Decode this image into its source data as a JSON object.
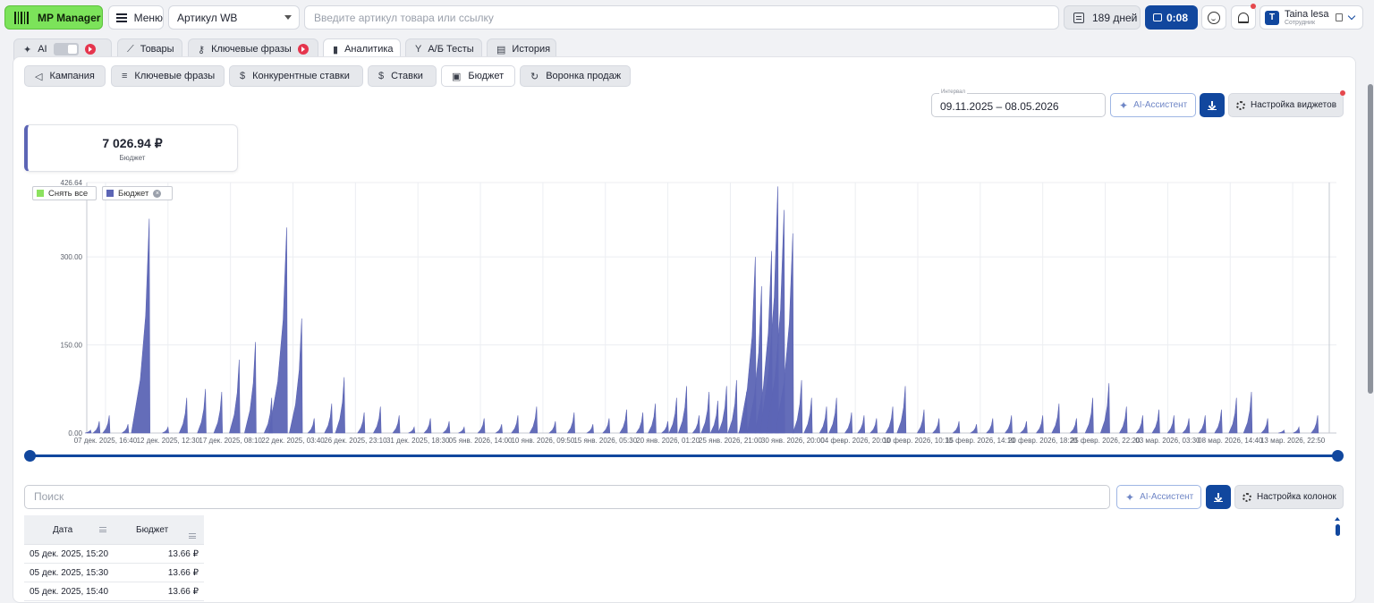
{
  "app": {
    "logo_text": "MP Manager"
  },
  "topbar": {
    "menu_label": "Меню",
    "article_select": "Артикул WB",
    "search_placeholder": "Введите артикул товара или ссылку",
    "days_label": "189 дней",
    "recording_time": "0:08",
    "user_name": "Taina lesa",
    "user_role": "Сотрудник",
    "user_initial": "T"
  },
  "tabs": [
    {
      "label": "AI"
    },
    {
      "label": "Товары"
    },
    {
      "label": "Ключевые фразы"
    },
    {
      "label": "Аналитика",
      "active": true
    },
    {
      "label": "А/Б Тесты"
    },
    {
      "label": "История"
    }
  ],
  "subtabs": [
    {
      "label": "Кампания"
    },
    {
      "label": "Ключевые фразы"
    },
    {
      "label": "Конкурентные ставки"
    },
    {
      "label": "Ставки"
    },
    {
      "label": "Бюджет",
      "active": true
    },
    {
      "label": "Воронка продаж"
    }
  ],
  "controls": {
    "interval_label": "Интервал",
    "interval_value": "09.11.2025 – 08.05.2026",
    "ai_assistant": "AI-Ассистент",
    "widget_settings": "Настройка виджетов",
    "column_settings": "Настройка колонок"
  },
  "kpi": {
    "value": "7 026.94 ₽",
    "label": "Бюджет"
  },
  "legend": {
    "deselect_all": "Снять все",
    "series_name": "Бюджет",
    "deselect_color": "#8ce25f",
    "series_color": "#5c65b5"
  },
  "chart_data": {
    "type": "area",
    "series": [
      {
        "name": "Бюджет",
        "color": "#5c65b5"
      }
    ],
    "ylim": [
      0,
      426.64
    ],
    "y_ticks": [
      "426.64",
      "300.00",
      "150.00",
      "0.00"
    ],
    "x_ticks": [
      "07 дек. 2025, 16:40",
      "12 дек. 2025, 12:30",
      "17 дек. 2025, 08:10",
      "22 дек. 2025, 03:40",
      "26 дек. 2025, 23:10",
      "31 дек. 2025, 18:30",
      "05 янв. 2026, 14:00",
      "10 янв. 2026, 09:50",
      "15 янв. 2026, 05:30",
      "20 янв. 2026, 01:20",
      "25 янв. 2026, 21:00",
      "30 янв. 2026, 20:00",
      "04 февр. 2026, 20:00",
      "10 февр. 2026, 10:10",
      "15 февр. 2026, 14:10",
      "20 февр. 2026, 18:20",
      "25 февр. 2026, 22:20",
      "03 мар. 2026, 03:30",
      "08 мар. 2026, 14:40",
      "13 мар. 2026, 22:50"
    ],
    "peaks": [
      [
        0.003,
        5
      ],
      [
        0.01,
        20
      ],
      [
        0.018,
        30
      ],
      [
        0.033,
        15
      ],
      [
        0.05,
        365
      ],
      [
        0.065,
        10
      ],
      [
        0.08,
        60
      ],
      [
        0.095,
        75
      ],
      [
        0.108,
        70
      ],
      [
        0.122,
        125
      ],
      [
        0.135,
        155
      ],
      [
        0.148,
        60
      ],
      [
        0.16,
        350
      ],
      [
        0.172,
        195
      ],
      [
        0.182,
        25
      ],
      [
        0.196,
        50
      ],
      [
        0.206,
        95
      ],
      [
        0.222,
        35
      ],
      [
        0.235,
        45
      ],
      [
        0.25,
        30
      ],
      [
        0.262,
        10
      ],
      [
        0.275,
        25
      ],
      [
        0.29,
        20
      ],
      [
        0.302,
        10
      ],
      [
        0.318,
        25
      ],
      [
        0.332,
        15
      ],
      [
        0.345,
        30
      ],
      [
        0.36,
        45
      ],
      [
        0.375,
        20
      ],
      [
        0.39,
        35
      ],
      [
        0.405,
        15
      ],
      [
        0.418,
        25
      ],
      [
        0.432,
        40
      ],
      [
        0.445,
        35
      ],
      [
        0.455,
        50
      ],
      [
        0.465,
        20
      ],
      [
        0.472,
        60
      ],
      [
        0.48,
        80
      ],
      [
        0.49,
        30
      ],
      [
        0.498,
        70
      ],
      [
        0.505,
        55
      ],
      [
        0.512,
        80
      ],
      [
        0.52,
        90
      ],
      [
        0.528,
        70
      ],
      [
        0.535,
        300
      ],
      [
        0.54,
        250
      ],
      [
        0.548,
        310
      ],
      [
        0.553,
        420
      ],
      [
        0.558,
        380
      ],
      [
        0.565,
        340
      ],
      [
        0.572,
        90
      ],
      [
        0.58,
        60
      ],
      [
        0.592,
        45
      ],
      [
        0.6,
        60
      ],
      [
        0.612,
        35
      ],
      [
        0.622,
        30
      ],
      [
        0.632,
        25
      ],
      [
        0.645,
        45
      ],
      [
        0.655,
        80
      ],
      [
        0.67,
        40
      ],
      [
        0.682,
        25
      ],
      [
        0.698,
        20
      ],
      [
        0.712,
        15
      ],
      [
        0.725,
        25
      ],
      [
        0.74,
        30
      ],
      [
        0.752,
        20
      ],
      [
        0.765,
        30
      ],
      [
        0.778,
        50
      ],
      [
        0.792,
        25
      ],
      [
        0.805,
        60
      ],
      [
        0.818,
        85
      ],
      [
        0.832,
        45
      ],
      [
        0.845,
        30
      ],
      [
        0.858,
        40
      ],
      [
        0.87,
        30
      ],
      [
        0.882,
        25
      ],
      [
        0.895,
        30
      ],
      [
        0.908,
        40
      ],
      [
        0.92,
        60
      ],
      [
        0.932,
        70
      ],
      [
        0.945,
        25
      ],
      [
        0.958,
        5
      ],
      [
        0.97,
        10
      ],
      [
        0.985,
        30
      ]
    ]
  },
  "table": {
    "search_placeholder": "Поиск",
    "columns": [
      "Дата",
      "Бюджет"
    ],
    "rows": [
      [
        "05 дек. 2025, 15:20",
        "13.66 ₽"
      ],
      [
        "05 дек. 2025, 15:30",
        "13.66 ₽"
      ],
      [
        "05 дек. 2025, 15:40",
        "13.66 ₽"
      ]
    ]
  }
}
